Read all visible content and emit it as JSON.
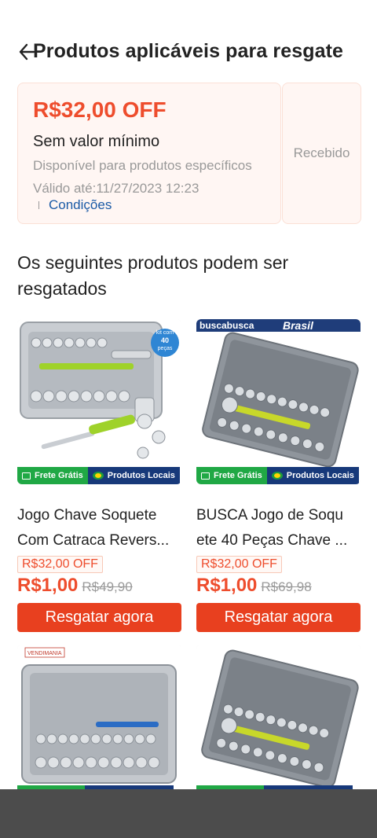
{
  "header": {
    "title": "Produtos aplicáveis para resgate"
  },
  "voucher": {
    "discount": "R$32,00 OFF",
    "min_spend": "Sem valor mínimo",
    "availability": "Disponível para produtos específicos",
    "validity": "Válido até:11/27/2023 12:23",
    "conditions_link": "Condições",
    "status": "Recebido"
  },
  "section": {
    "title": "Os seguintes produtos podem ser resgatados"
  },
  "tags": {
    "free_shipping": "Frete Grátis",
    "local_products": "Produtos Locais"
  },
  "images": {
    "kit_badge_1": "kit com",
    "kit_badge_2": "40",
    "kit_badge_3": "peças",
    "banner_brand": "buscabusca",
    "banner_country": "Brasil",
    "shop_logo": "VENDIMANIA"
  },
  "products": [
    {
      "name_line1": "Jogo Chave Soquete",
      "name_line2": "Com Catraca Revers...",
      "coupon": "R$32,00 OFF",
      "price": "R$1,00",
      "old_price": "R$49,90",
      "button": "Resgatar agora"
    },
    {
      "name_line1": "BUSCA Jogo de Soqu",
      "name_line2": "ete 40 Peças Chave ...",
      "coupon": "R$32,00 OFF",
      "price": "R$1,00",
      "old_price": "R$69,98",
      "button": "Resgatar agora"
    }
  ],
  "colors": {
    "accent": "#ee4d2d",
    "button": "#e8401f",
    "voucher_bg": "#fff6f3",
    "link": "#1b5aa6",
    "tag_green": "#20a845",
    "tag_navy": "#17397a"
  }
}
